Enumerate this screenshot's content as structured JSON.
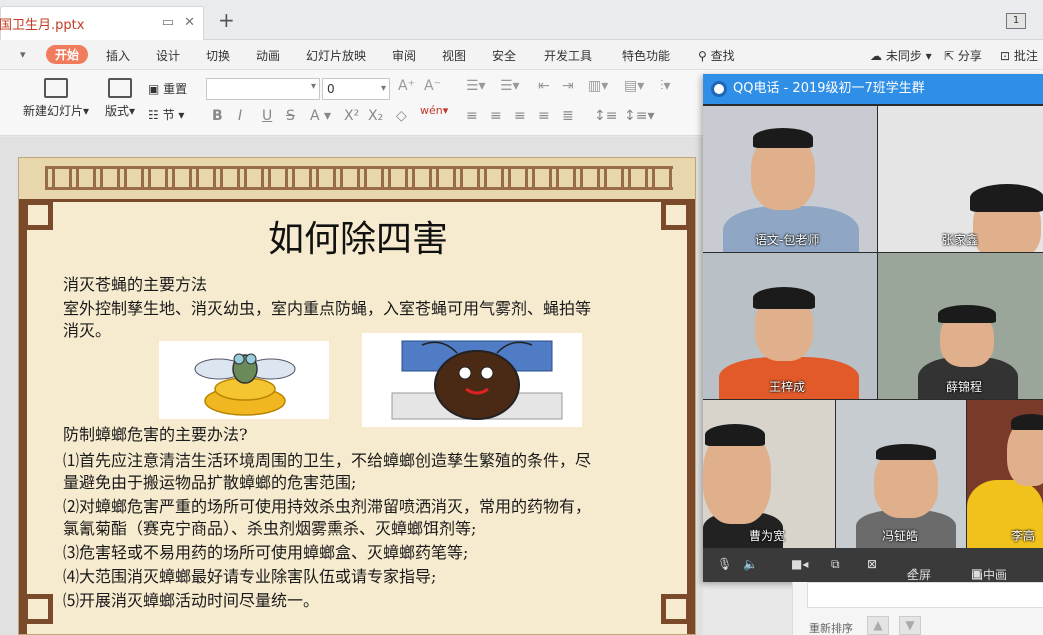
{
  "tab": {
    "filename": "国卫生月.pptx",
    "page_count": "1"
  },
  "menu": {
    "items": [
      "开始",
      "插入",
      "设计",
      "切换",
      "动画",
      "幻灯片放映",
      "审阅",
      "视图",
      "安全",
      "开发工具",
      "特色功能"
    ],
    "search": "查找",
    "right": [
      "未同步",
      "分享",
      "批注"
    ]
  },
  "ribbon": {
    "new_slide": "新建幻灯片",
    "layout": "版式",
    "reset": "重置",
    "section": "节",
    "font_size": "0"
  },
  "slide": {
    "title": "如何除四害",
    "p1_heading": "消灭苍蝇的主要方法",
    "p1_body_1": "室外控制孳生地、消灭幼虫，室内重点防蝇，入室苍蝇可用气雾剂、蝇拍等",
    "p1_body_2": "消灭。",
    "p2_heading": "防制蟑螂危害的主要办法?",
    "items": [
      "⑴首先应注意清洁生活环境周围的卫生，不给蟑螂创造孳生繁殖的条件，尽",
      "量避免由于搬运物品扩散蟑螂的危害范围;",
      "⑵对蟑螂危害严重的场所可使用持效杀虫剂滞留喷洒消灭，常用的药物有，",
      "氯氰菊酯（赛克宁商品）、杀虫剂烟雾熏杀、灭蟑螂饵剂等;",
      "⑶危害轻或不易用药的场所可使用蟑螂盒、灭蟑螂药笔等;",
      "⑷大范围消灭蟑螂最好请专业除害队伍或请专家指导;",
      "⑸开展消灭蟑螂活动时间尽量统一。"
    ]
  },
  "qq": {
    "title": "QQ电话 - 2019级初一7班学生群",
    "participants": [
      "语文-包老师",
      "张家鑫",
      "王梓成",
      "薛锦程",
      "曹为宽",
      "冯钲皓",
      "李高"
    ],
    "controls": {
      "fullscreen": "全屏",
      "pip": "画中画"
    }
  },
  "chat": {
    "sort_label": "重新排序"
  }
}
